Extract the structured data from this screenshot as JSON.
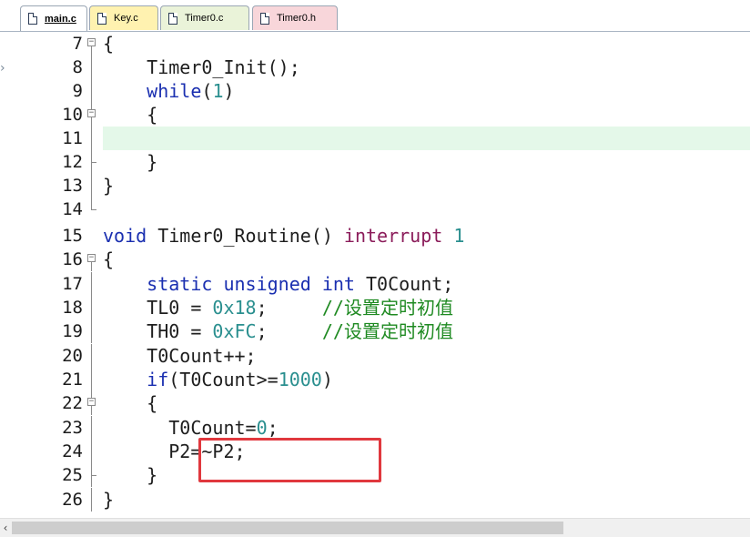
{
  "tabs": [
    {
      "label": "main.c",
      "active": true,
      "color": "#ffffff"
    },
    {
      "label": "Key.c",
      "active": false,
      "color": "#fff2b0"
    },
    {
      "label": "Timer0.c",
      "active": false,
      "color": "#eaf3d9"
    },
    {
      "label": "Timer0.h",
      "active": false,
      "color": "#f8d6da"
    }
  ],
  "editor": {
    "current_line": "11",
    "lines": [
      {
        "no": "7"
      },
      {
        "no": "8"
      },
      {
        "no": "9"
      },
      {
        "no": "10"
      },
      {
        "no": "11"
      },
      {
        "no": "12"
      },
      {
        "no": "13"
      },
      {
        "no": "14"
      },
      {
        "no": "15"
      },
      {
        "no": "16"
      },
      {
        "no": "17"
      },
      {
        "no": "18"
      },
      {
        "no": "19"
      },
      {
        "no": "20"
      },
      {
        "no": "21"
      },
      {
        "no": "22"
      },
      {
        "no": "23"
      },
      {
        "no": "24"
      },
      {
        "no": "25"
      },
      {
        "no": "26"
      }
    ],
    "code": {
      "l7_brace": "{",
      "l8_call": "Timer0_Init();",
      "l9_while": "while",
      "l9_open": "(",
      "l9_num": "1",
      "l9_close": ")",
      "l10_brace": "{",
      "l12_brace": "}",
      "l13_brace": "}",
      "l15_void": "void",
      "l15_name": " Timer0_Routine() ",
      "l15_interrupt": "interrupt",
      "l15_num": "1",
      "l16_brace": "{",
      "l17_static": "static",
      "l17_unsigned": "unsigned",
      "l17_int": "int",
      "l17_var": " T0Count;",
      "l18_lhs": "TL0 = ",
      "l18_num": "0x18",
      "l18_semi": ";",
      "l18_comment": "//设置定时初值",
      "l19_lhs": "TH0 = ",
      "l19_num": "0xFC",
      "l19_semi": ";",
      "l19_comment": "//设置定时初值",
      "l20_stmt": "T0Count++;",
      "l21_if": "if",
      "l21_cond": "(T0Count>=",
      "l21_num": "1000",
      "l21_close": ")",
      "l22_brace": "{",
      "l23_lhs": "T0Count=",
      "l23_num": "0",
      "l23_semi": ";",
      "l24_stmt": "P2=~P2;",
      "l25_brace": "}",
      "l26_brace": "}"
    }
  },
  "icons": {
    "bookmark": "chevron-right-icon",
    "scroll_left": "scroll-left-arrow-icon"
  },
  "colors": {
    "keyword": "#1a2fb0",
    "interrupt_keyword": "#8b1c5a",
    "number": "#2a8f8f",
    "comment": "#1f8a22",
    "current_line_bg": "#e4f8e9",
    "highlight_border": "#e0383e"
  }
}
